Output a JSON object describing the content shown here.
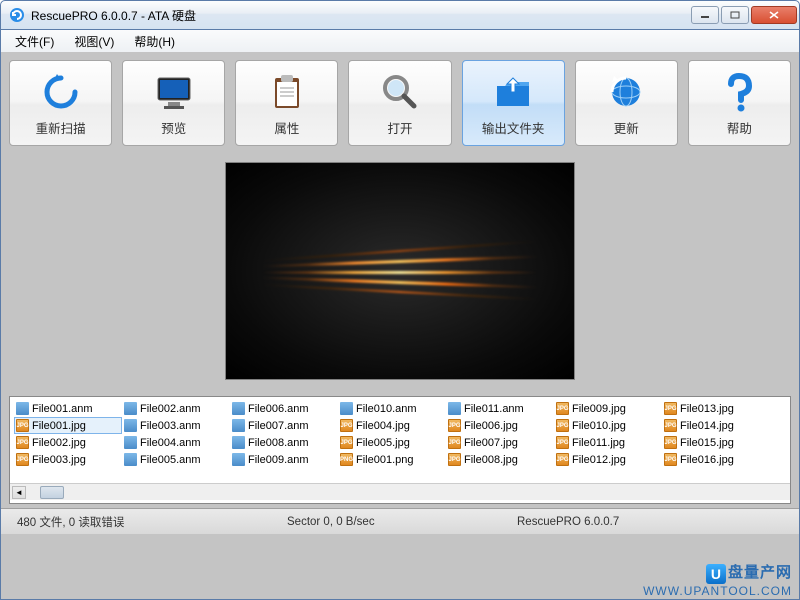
{
  "window": {
    "title": "RescuePRO 6.0.0.7 - ATA 硬盘",
    "app_icon": "rescue-icon"
  },
  "menu": {
    "items": [
      {
        "label": "文件(F)"
      },
      {
        "label": "视图(V)"
      },
      {
        "label": "帮助(H)"
      }
    ]
  },
  "toolbar": {
    "buttons": [
      {
        "id": "rescan",
        "label": "重新扫描",
        "icon": "refresh-arrow-icon"
      },
      {
        "id": "preview",
        "label": "预览",
        "icon": "monitor-icon"
      },
      {
        "id": "properties",
        "label": "属性",
        "icon": "clipboard-icon"
      },
      {
        "id": "open",
        "label": "打开",
        "icon": "magnifier-icon"
      },
      {
        "id": "output",
        "label": "输出文件夹",
        "icon": "folder-up-icon",
        "selected": true
      },
      {
        "id": "update",
        "label": "更新",
        "icon": "globe-refresh-icon"
      },
      {
        "id": "help",
        "label": "帮助",
        "icon": "question-icon"
      }
    ]
  },
  "files": {
    "columns": [
      [
        {
          "name": "File001.anm",
          "ext": "anm"
        },
        {
          "name": "File001.jpg",
          "ext": "jpg",
          "selected": true
        },
        {
          "name": "File002.jpg",
          "ext": "jpg"
        },
        {
          "name": "File003.jpg",
          "ext": "jpg"
        }
      ],
      [
        {
          "name": "File002.anm",
          "ext": "anm"
        },
        {
          "name": "File003.anm",
          "ext": "anm"
        },
        {
          "name": "File004.anm",
          "ext": "anm"
        },
        {
          "name": "File005.anm",
          "ext": "anm"
        }
      ],
      [
        {
          "name": "File006.anm",
          "ext": "anm"
        },
        {
          "name": "File007.anm",
          "ext": "anm"
        },
        {
          "name": "File008.anm",
          "ext": "anm"
        },
        {
          "name": "File009.anm",
          "ext": "anm"
        }
      ],
      [
        {
          "name": "File010.anm",
          "ext": "anm"
        },
        {
          "name": "File004.jpg",
          "ext": "jpg"
        },
        {
          "name": "File005.jpg",
          "ext": "jpg"
        },
        {
          "name": "File001.png",
          "ext": "png"
        }
      ],
      [
        {
          "name": "File011.anm",
          "ext": "anm"
        },
        {
          "name": "File006.jpg",
          "ext": "jpg"
        },
        {
          "name": "File007.jpg",
          "ext": "jpg"
        },
        {
          "name": "File008.jpg",
          "ext": "jpg"
        }
      ],
      [
        {
          "name": "File009.jpg",
          "ext": "jpg"
        },
        {
          "name": "File010.jpg",
          "ext": "jpg"
        },
        {
          "name": "File011.jpg",
          "ext": "jpg"
        },
        {
          "name": "File012.jpg",
          "ext": "jpg"
        }
      ],
      [
        {
          "name": "File013.jpg",
          "ext": "jpg"
        },
        {
          "name": "File014.jpg",
          "ext": "jpg"
        },
        {
          "name": "File015.jpg",
          "ext": "jpg"
        },
        {
          "name": "File016.jpg",
          "ext": "jpg"
        }
      ]
    ]
  },
  "status": {
    "left": "480 文件, 0 读取错误",
    "center": "Sector 0, 0 B/sec",
    "right": "RescuePRO 6.0.0.7"
  },
  "watermark": {
    "cn": "盘量产网",
    "url": "WWW.UPANTOOL.COM"
  }
}
